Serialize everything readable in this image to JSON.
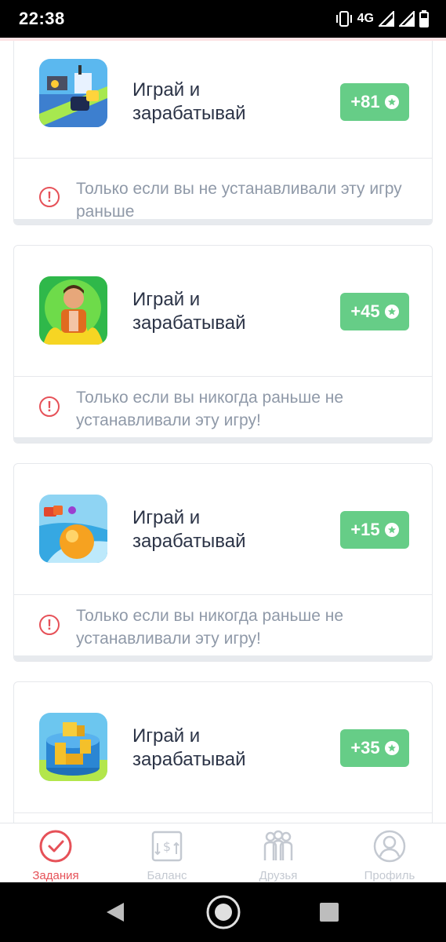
{
  "status_bar": {
    "time": "22:38",
    "network": "4G"
  },
  "tasks": [
    {
      "title": "Играй и\nзарабатывай",
      "reward": "+81",
      "warning": "Только если вы не устанавливали эту игру\nраньше",
      "icon": "game-icon-city"
    },
    {
      "title": "Играй и\nзарабатывай",
      "reward": "+45",
      "warning": "Только если вы никогда раньше не\nустанавливали эту игру!",
      "icon": "game-icon-money-man"
    },
    {
      "title": "Играй и\nзарабатывай",
      "reward": "+15",
      "warning": "Только если вы никогда раньше не\nустанавливали эту игру!",
      "icon": "game-icon-ball-race"
    },
    {
      "title": "Играй и\nзарабатывай",
      "reward": "+35",
      "warning": "",
      "icon": "game-icon-block-tower"
    }
  ],
  "bottom_nav": {
    "items": [
      {
        "label": "Задания",
        "icon": "check-circle-icon",
        "active": true
      },
      {
        "label": "Баланс",
        "icon": "balance-icon",
        "active": false
      },
      {
        "label": "Друзья",
        "icon": "friends-icon",
        "active": false
      },
      {
        "label": "Профиль",
        "icon": "profile-icon",
        "active": false
      }
    ]
  },
  "colors": {
    "accent": "#e65158",
    "reward_bg": "#66cd87",
    "muted_text": "#8f99a8",
    "title_text": "#2c3447"
  }
}
